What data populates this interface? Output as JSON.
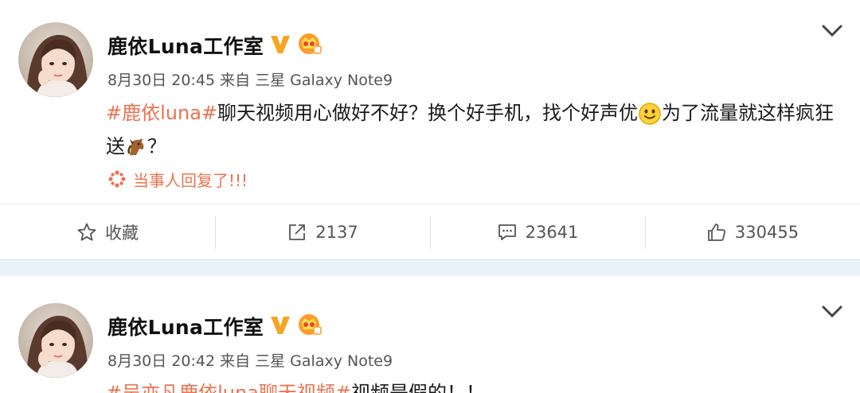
{
  "posts": [
    {
      "author": "鹿依Luna工作室",
      "meta": "8月30日 20:45 来自 三星 Galaxy Note9",
      "topic": "#鹿依luna#",
      "text_part1": "聊天视频用心做好不好？换个好手机，找个好声优",
      "text_part2": "为了流量就这样疯狂送",
      "text_part3": "？",
      "reply_label": "当事人回复了!!!",
      "actions": {
        "favorite": "收藏",
        "repost_count": "2137",
        "comment_count": "23641",
        "like_count": "330455"
      }
    },
    {
      "author": "鹿依Luna工作室",
      "meta": "8月30日 20:42 来自 三星 Galaxy Note9",
      "topic": "#吴亦凡鹿依luna聊天视频#",
      "text": "视频是假的！！"
    }
  ],
  "colors": {
    "accent": "#eb7350",
    "verified": "#f5a623",
    "separator": "#e9f2f8"
  },
  "icons": {
    "verified": "verified-v-icon",
    "crown": "member-crown-icon",
    "more": "chevron-down-icon",
    "favorite": "star-icon",
    "repost": "repost-icon",
    "comment": "comment-icon",
    "like": "thumbs-up-icon",
    "reply": "reply-spark-icon"
  }
}
